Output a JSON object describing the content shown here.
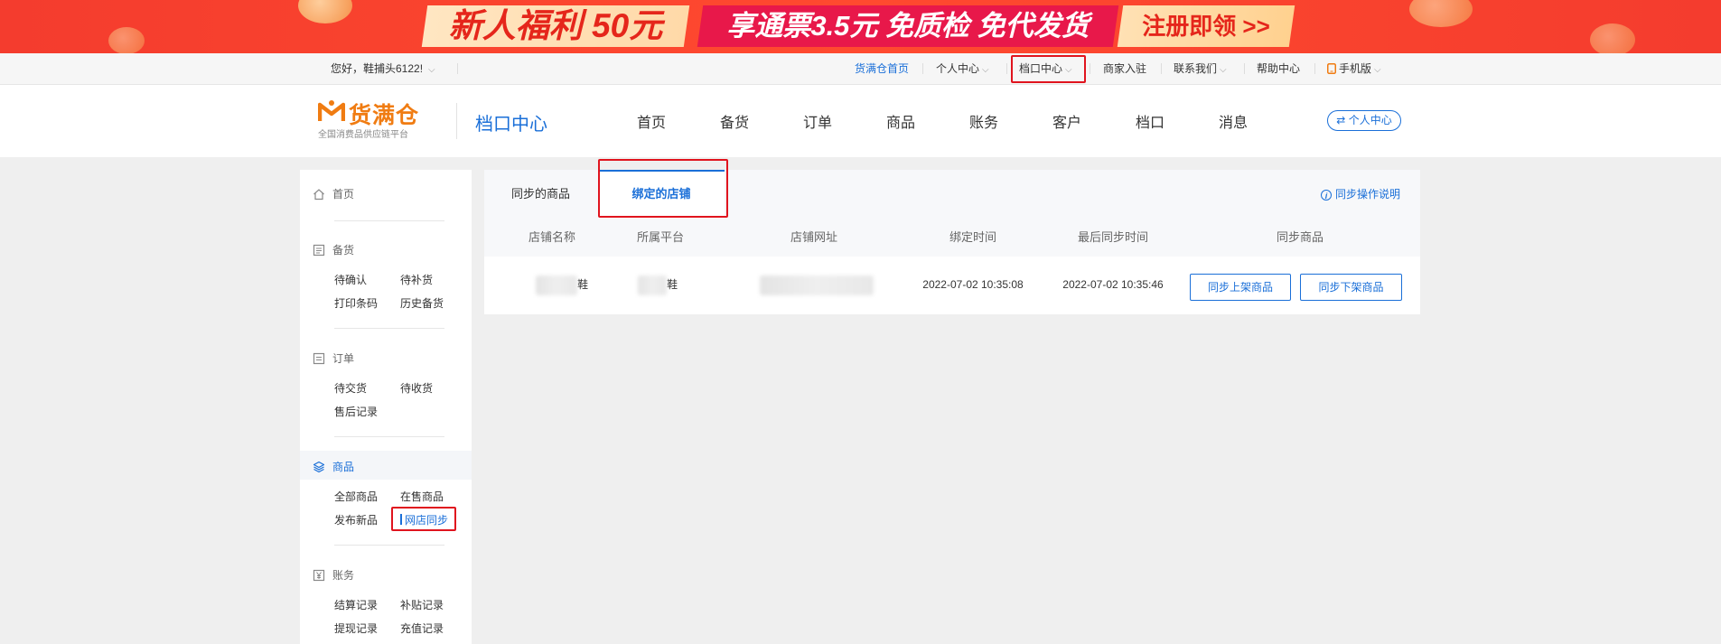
{
  "banner": {
    "offer": "新人福利 50元",
    "perks": "享通票3.5元  免质检 免代发货",
    "cta": "注册即领 >>"
  },
  "topbar": {
    "greeting": "您好，鞋捕头6122!",
    "links": {
      "home": "货满仓首页",
      "personal": "个人中心",
      "stall": "档口中心",
      "merchant": "商家入驻",
      "contact": "联系我们",
      "help": "帮助中心",
      "mobile": "手机版"
    }
  },
  "header": {
    "logo_name": "货满仓",
    "logo_tagline": "全国消费品供应链平台",
    "section_title": "档口中心",
    "nav": [
      "首页",
      "备货",
      "订单",
      "商品",
      "账务",
      "客户",
      "档口",
      "消息"
    ],
    "personal_center_btn": "个人中心"
  },
  "sidebar": {
    "home": "首页",
    "stock": {
      "title": "备货",
      "items": [
        "待确认",
        "待补货",
        "打印条码",
        "历史备货"
      ]
    },
    "orders": {
      "title": "订单",
      "items": [
        "待交货",
        "待收货",
        "售后记录"
      ]
    },
    "products": {
      "title": "商品",
      "items": [
        "全部商品",
        "在售商品",
        "发布新品",
        "网店同步"
      ]
    },
    "accounts": {
      "title": "账务",
      "items": [
        "结算记录",
        "补贴记录",
        "提现记录",
        "充值记录"
      ]
    }
  },
  "content": {
    "tabs": [
      "同步的商品",
      "绑定的店铺"
    ],
    "active_tab": "绑定的店铺",
    "help_link": "同步操作说明",
    "columns": [
      "店铺名称",
      "所属平台",
      "店铺网址",
      "绑定时间",
      "最后同步时间",
      "同步商品"
    ],
    "rows": [
      {
        "store_name_suffix": "鞋",
        "platform_suffix": "鞋",
        "bind_time": "2022-07-02 10:35:08",
        "last_sync_time": "2022-07-02 10:35:46",
        "action_up": "同步上架商品",
        "action_down": "同步下架商品"
      }
    ]
  },
  "colors": {
    "accent": "#1a6fd8",
    "banner_red": "#f43c2e",
    "highlight": "#e0141e",
    "logo_orange": "#f07c12"
  }
}
